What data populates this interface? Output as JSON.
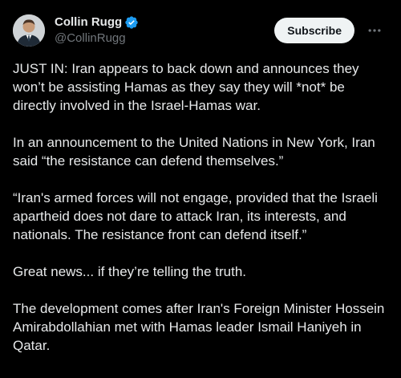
{
  "author": {
    "name": "Collin Rugg",
    "handle": "@CollinRugg",
    "verified_icon": "verified-badge-icon",
    "avatar": "avatar-photo"
  },
  "actions": {
    "subscribe_label": "Subscribe",
    "more_icon": "more-horizontal-icon"
  },
  "paragraphs": [
    "JUST IN: Iran appears to back down and announces they won’t be assisting Hamas as they say they will *not* be directly involved in the Israel-Hamas war.",
    "In an announcement to the United Nations in New York, Iran said “the resistance can defend themselves.”",
    "“Iran's armed forces will not engage, provided that the Israeli apartheid does not dare to attack Iran, its interests, and nationals. The resistance front can defend itself.”",
    "Great news... if they’re telling the truth.",
    "The development comes after Iran's Foreign Minister Hossein Amirabdollahian met with Hamas leader Ismail Haniyeh in Qatar."
  ],
  "colors": {
    "background": "#000000",
    "text": "#e7e9ea",
    "secondary": "#71767b",
    "verified": "#1d9bf0",
    "button_bg": "#eff3f4"
  }
}
